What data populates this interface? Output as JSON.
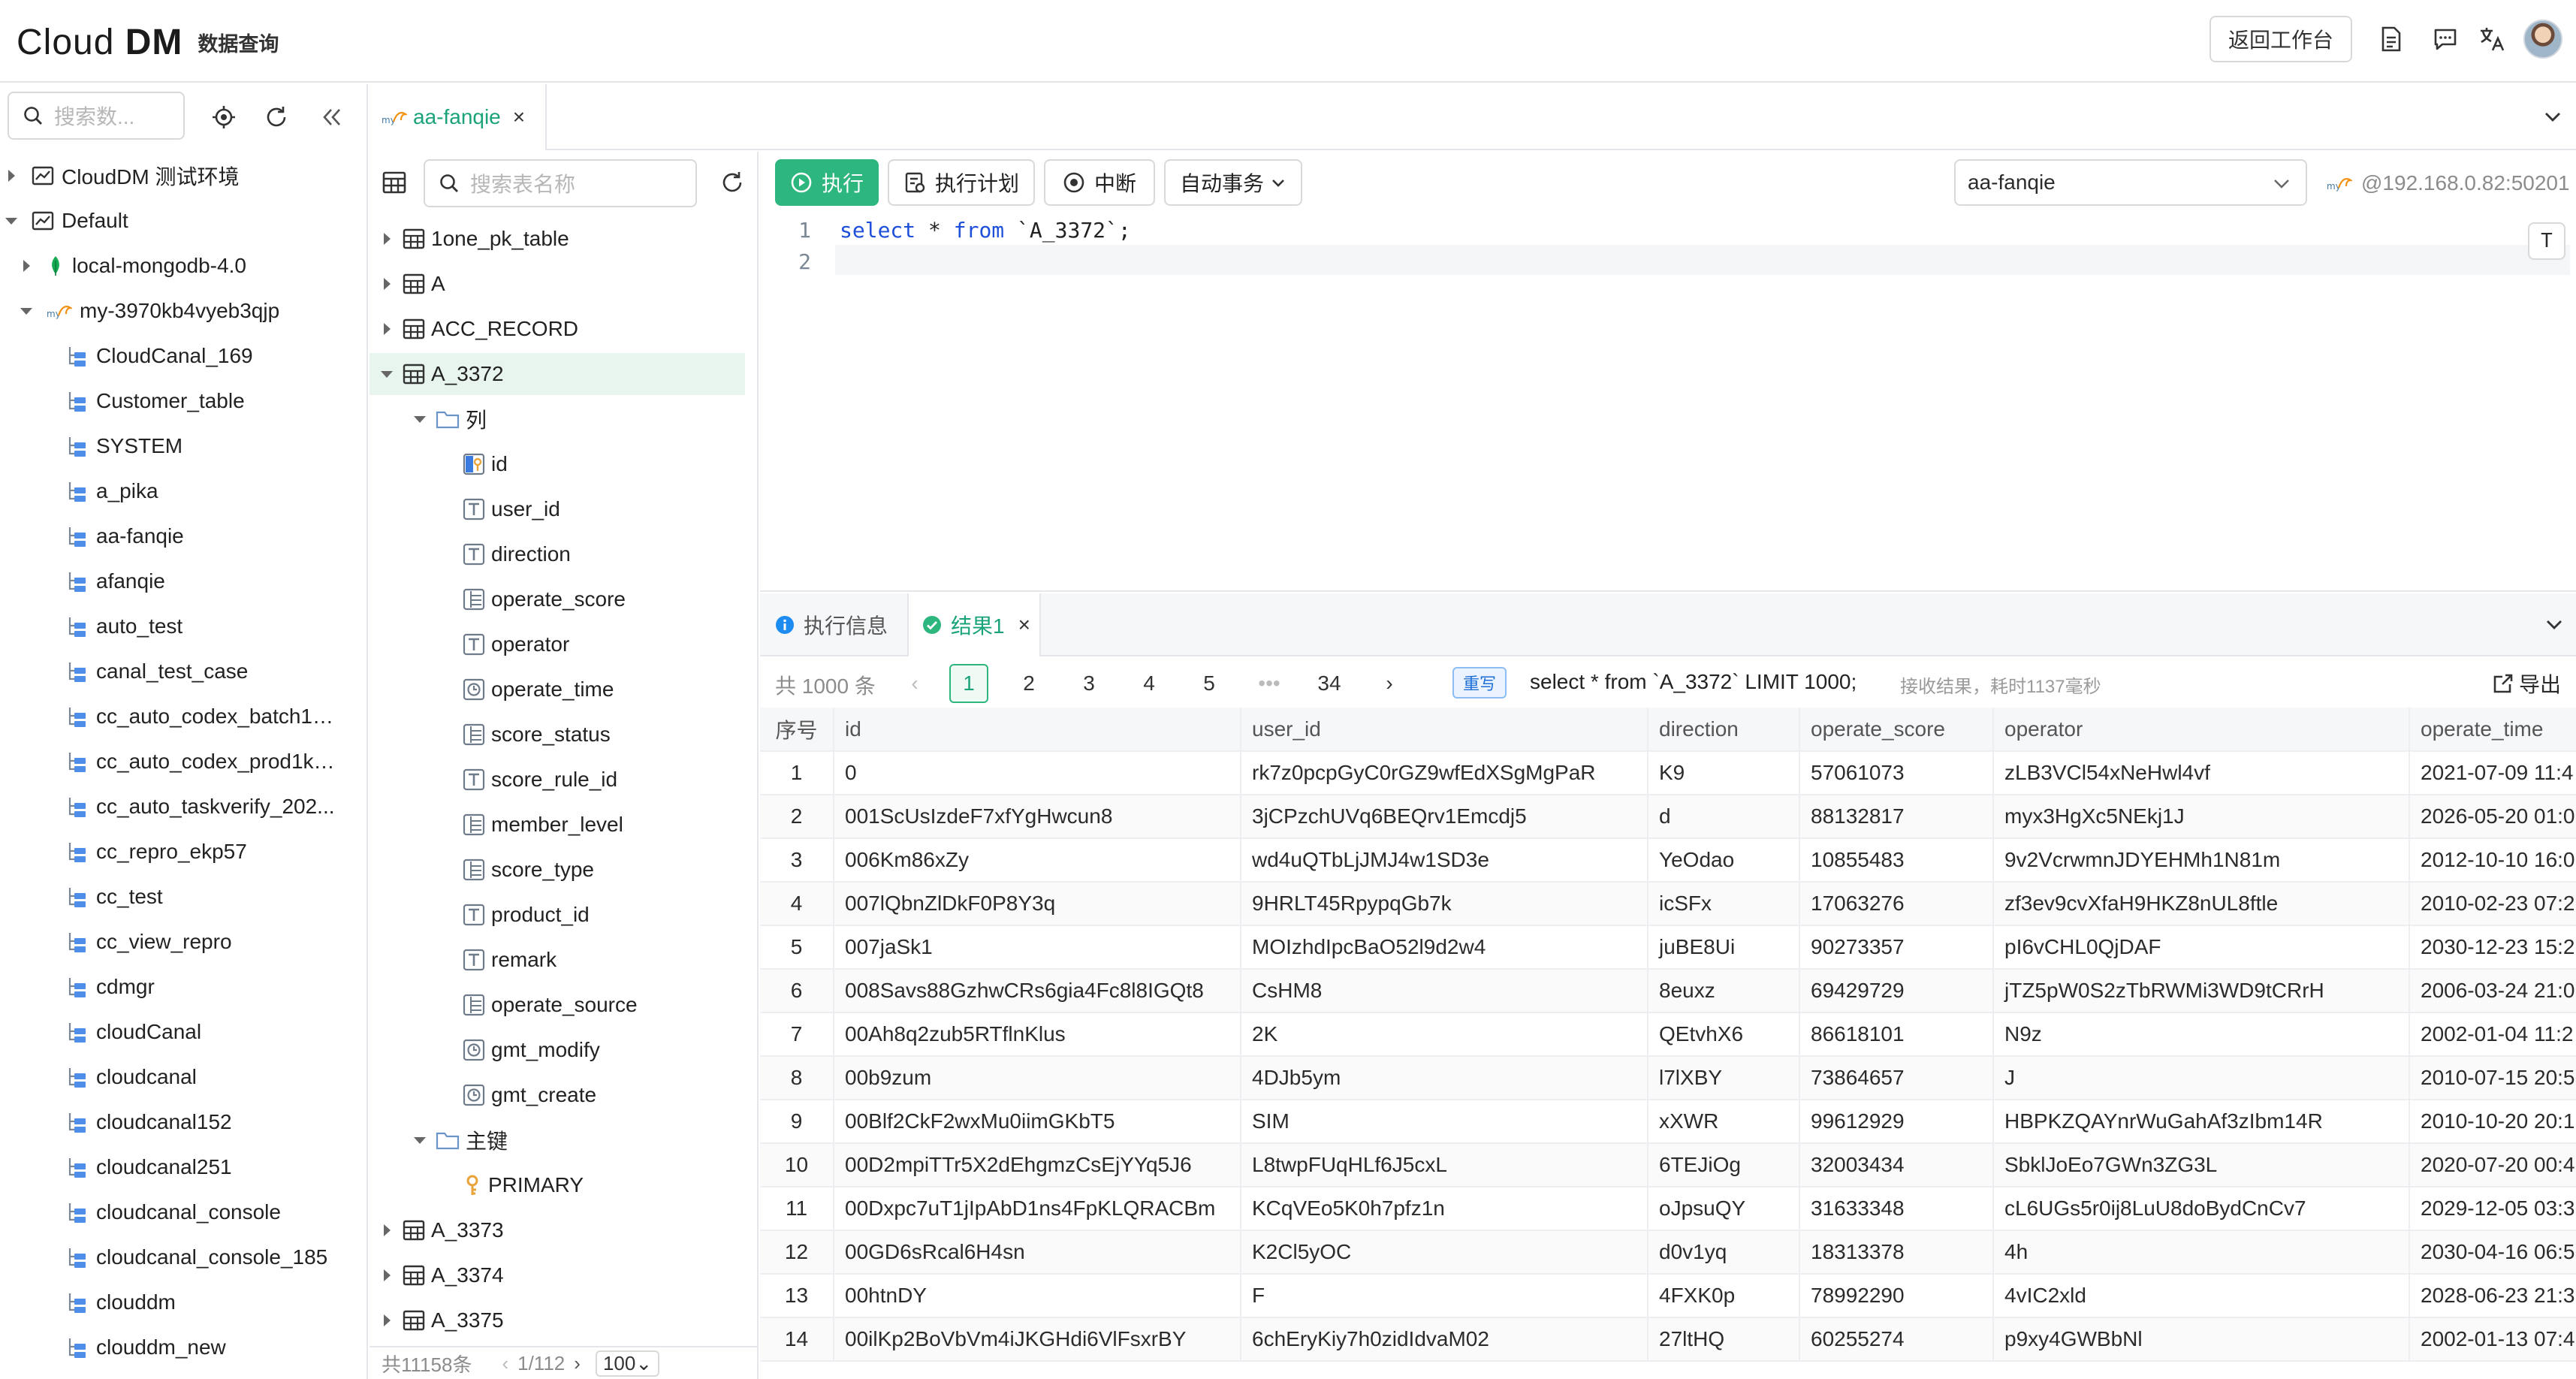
{
  "topbar": {
    "brand_light": "Cl",
    "brand_o": "o",
    "brand_rest": "ud ",
    "brand_bold": "DM",
    "subtitle": "数据查询",
    "back_label": "返回工作台"
  },
  "sidebar": {
    "search_placeholder": "搜索数...",
    "tree": [
      {
        "label": "CloudDM 测试环境",
        "level": 0,
        "icon": "env-icon",
        "expanded": false
      },
      {
        "label": "Default",
        "level": 0,
        "icon": "env-icon",
        "expanded": true
      },
      {
        "label": "local-mongodb-4.0",
        "level": 1,
        "icon": "mongodb-leaf-icon",
        "expanded": false
      },
      {
        "label": "my-3970kb4vyeb3qjp",
        "level": 1,
        "icon": "mysql-icon",
        "expanded": true
      },
      {
        "label": "CloudCanal_169",
        "level": 2,
        "icon": "schema-icon"
      },
      {
        "label": "Customer_table",
        "level": 2,
        "icon": "schema-icon"
      },
      {
        "label": "SYSTEM",
        "level": 2,
        "icon": "schema-icon"
      },
      {
        "label": "a_pika",
        "level": 2,
        "icon": "schema-icon"
      },
      {
        "label": "aa-fanqie",
        "level": 2,
        "icon": "schema-icon"
      },
      {
        "label": "afanqie",
        "level": 2,
        "icon": "schema-icon"
      },
      {
        "label": "auto_test",
        "level": 2,
        "icon": "schema-icon"
      },
      {
        "label": "canal_test_case",
        "level": 2,
        "icon": "schema-icon"
      },
      {
        "label": "cc_auto_codex_batch1_...",
        "level": 2,
        "icon": "schema-icon"
      },
      {
        "label": "cc_auto_codex_prod1k_...",
        "level": 2,
        "icon": "schema-icon"
      },
      {
        "label": "cc_auto_taskverify_202...",
        "level": 2,
        "icon": "schema-icon"
      },
      {
        "label": "cc_repro_ekp57",
        "level": 2,
        "icon": "schema-icon"
      },
      {
        "label": "cc_test",
        "level": 2,
        "icon": "schema-icon"
      },
      {
        "label": "cc_view_repro",
        "level": 2,
        "icon": "schema-icon"
      },
      {
        "label": "cdmgr",
        "level": 2,
        "icon": "schema-icon"
      },
      {
        "label": "cloudCanal",
        "level": 2,
        "icon": "schema-icon"
      },
      {
        "label": "cloudcanal",
        "level": 2,
        "icon": "schema-icon"
      },
      {
        "label": "cloudcanal152",
        "level": 2,
        "icon": "schema-icon"
      },
      {
        "label": "cloudcanal251",
        "level": 2,
        "icon": "schema-icon"
      },
      {
        "label": "cloudcanal_console",
        "level": 2,
        "icon": "schema-icon"
      },
      {
        "label": "cloudcanal_console_185",
        "level": 2,
        "icon": "schema-icon"
      },
      {
        "label": "clouddm",
        "level": 2,
        "icon": "schema-icon"
      },
      {
        "label": "clouddm_new",
        "level": 2,
        "icon": "schema-icon"
      }
    ]
  },
  "file_tab": {
    "label": "aa-fanqie",
    "close": "×"
  },
  "table_panel": {
    "search_placeholder": "搜索表名称",
    "rows": [
      {
        "label": "1one_pk_table",
        "kind": "table",
        "indent": 0,
        "caret": "right"
      },
      {
        "label": "A",
        "kind": "table",
        "indent": 0,
        "caret": "right"
      },
      {
        "label": "ACC_RECORD",
        "kind": "table",
        "indent": 0,
        "caret": "right"
      },
      {
        "label": "A_3372",
        "kind": "table",
        "indent": 0,
        "caret": "down",
        "selected": true
      },
      {
        "label": "列",
        "kind": "folder",
        "indent": 1,
        "caret": "down"
      },
      {
        "label": "id",
        "kind": "pk",
        "indent": 2
      },
      {
        "label": "user_id",
        "kind": "T",
        "indent": 2
      },
      {
        "label": "direction",
        "kind": "T",
        "indent": 2
      },
      {
        "label": "operate_score",
        "kind": "num",
        "indent": 2
      },
      {
        "label": "operator",
        "kind": "T",
        "indent": 2
      },
      {
        "label": "operate_time",
        "kind": "time",
        "indent": 2
      },
      {
        "label": "score_status",
        "kind": "num",
        "indent": 2
      },
      {
        "label": "score_rule_id",
        "kind": "T",
        "indent": 2
      },
      {
        "label": "member_level",
        "kind": "num",
        "indent": 2
      },
      {
        "label": "score_type",
        "kind": "num",
        "indent": 2
      },
      {
        "label": "product_id",
        "kind": "T",
        "indent": 2
      },
      {
        "label": "remark",
        "kind": "T",
        "indent": 2
      },
      {
        "label": "operate_source",
        "kind": "num",
        "indent": 2
      },
      {
        "label": "gmt_modify",
        "kind": "time",
        "indent": 2
      },
      {
        "label": "gmt_create",
        "kind": "time",
        "indent": 2
      },
      {
        "label": "主键",
        "kind": "folder",
        "indent": 1,
        "caret": "down"
      },
      {
        "label": "PRIMARY",
        "kind": "key",
        "indent": 2
      },
      {
        "label": "A_3373",
        "kind": "table",
        "indent": 0,
        "caret": "right"
      },
      {
        "label": "A_3374",
        "kind": "table",
        "indent": 0,
        "caret": "right"
      },
      {
        "label": "A_3375",
        "kind": "table",
        "indent": 0,
        "caret": "right"
      }
    ],
    "footer_count": "共11158条",
    "footer_pages": "1/112",
    "footer_size": "100"
  },
  "toolbar": {
    "run": "执行",
    "plan": "执行计划",
    "stop": "中断",
    "tx": "自动事务",
    "db": "aa-fanqie",
    "conn": "@192.168.0.82:50201"
  },
  "editor": {
    "line1_no": "1",
    "line2_no": "2",
    "kw_select": "select",
    "mid": " * ",
    "kw_from": "from",
    "tail": " `A_3372`;",
    "t_label": "T"
  },
  "results": {
    "tab_info": "执行信息",
    "tab_result": "结果1",
    "total": "共 1000 条",
    "pages": [
      "1",
      "2",
      "3",
      "4",
      "5",
      "•••",
      "34"
    ],
    "rw": "重写",
    "sql": "select * from `A_3372` LIMIT 1000;",
    "timing": "接收结果，耗时1137毫秒",
    "export": "导出",
    "columns": [
      "序号",
      "id",
      "user_id",
      "direction",
      "operate_score",
      "operator",
      "operate_time"
    ],
    "rows": [
      [
        "1",
        "0",
        "rk7z0pcpGyC0rGZ9wfEdXSgMgPaR",
        "K9",
        "57061073",
        "zLB3VCl54xNeHwl4vf",
        "2021-07-09 11:4"
      ],
      [
        "2",
        "001ScUsIzdeF7xfYgHwcun8",
        "3jCPzchUVq6BEQrv1Emcdj5",
        "d",
        "88132817",
        "myx3HgXc5NEkj1J",
        "2026-05-20 01:0"
      ],
      [
        "3",
        "006Km86xZy",
        "wd4uQTbLjJMJ4w1SD3e",
        "YeOdao",
        "10855483",
        "9v2VcrwmnJDYEHMh1N81m",
        "2012-10-10 16:0"
      ],
      [
        "4",
        "007lQbnZlDkF0P8Y3q",
        "9HRLT45RpypqGb7k",
        "icSFx",
        "17063276",
        "zf3ev9cvXfaH9HKZ8nUL8ftle",
        "2010-02-23 07:2"
      ],
      [
        "5",
        "007jaSk1",
        "MOIzhdIpcBaO52l9d2w4",
        "juBE8Ui",
        "90273357",
        "pI6vCHL0QjDAF",
        "2030-12-23 15:2"
      ],
      [
        "6",
        "008Savs88GzhwCRs6gia4Fc8l8IGQt8",
        "CsHM8",
        "8euxz",
        "69429729",
        "jTZ5pW0S2zTbRWMi3WD9tCRrH",
        "2006-03-24 21:0"
      ],
      [
        "7",
        "00Ah8q2zub5RTflnKlus",
        "2K",
        "QEtvhX6",
        "86618101",
        "N9z",
        "2002-01-04 11:2"
      ],
      [
        "8",
        "00b9zum",
        "4DJb5ym",
        "l7lXBY",
        "73864657",
        "J",
        "2010-07-15 20:5"
      ],
      [
        "9",
        "00Blf2CkF2wxMu0iimGKbT5",
        "SIM",
        "xXWR",
        "99612929",
        "HBPKZQAYnrWuGahAf3zIbm14R",
        "2010-10-20 20:1"
      ],
      [
        "10",
        "00D2mpiTTr5X2dEhgmzCsEjYYq5J6",
        "L8twpFUqHLf6J5cxL",
        "6TEJiOg",
        "32003434",
        "SbklJoEo7GWn3ZG3L",
        "2020-07-20 00:4"
      ],
      [
        "11",
        "00Dxpc7uT1jIpAbD1ns4FpKLQRACBm",
        "KCqVEo5K0h7pfz1n",
        "oJpsuQY",
        "31633348",
        "cL6UGs5r0ij8LuU8doBydCnCv7",
        "2029-12-05 03:3"
      ],
      [
        "12",
        "00GD6sRcal6H4sn",
        "K2Cl5yOC",
        "d0v1yq",
        "18313378",
        "4h",
        "2030-04-16 06:5"
      ],
      [
        "13",
        "00htnDY",
        "F",
        "4FXK0p",
        "78992290",
        "4vIC2xld",
        "2028-06-23 21:3"
      ],
      [
        "14",
        "00ilKp2BoVbVm4iJKGHdi6VlFsxrBY",
        "6chEryKiy7h0zidIdvaM02",
        "27ltHQ",
        "60255274",
        "p9xy4GWBbNl",
        "2002-01-13 07:4"
      ]
    ]
  }
}
